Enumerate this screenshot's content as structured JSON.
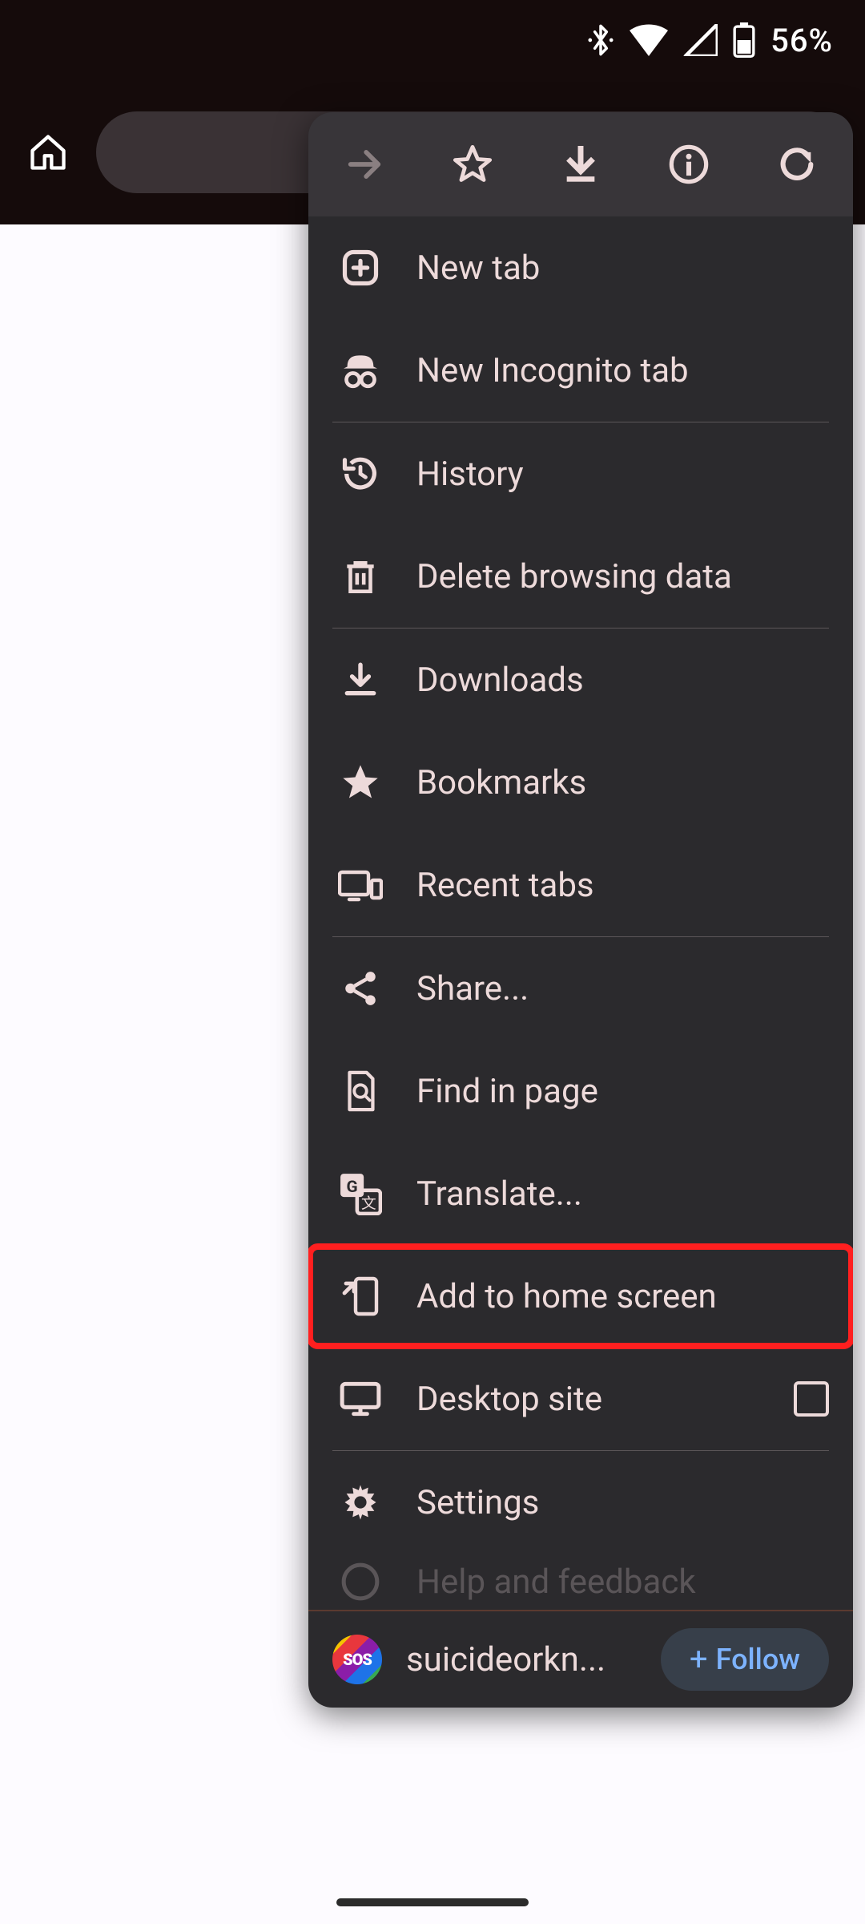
{
  "statusbar": {
    "battery_text": "56%"
  },
  "menu": {
    "items": {
      "new_tab": "New tab",
      "incognito": "New Incognito tab",
      "history": "History",
      "delete_data": "Delete browsing data",
      "downloads": "Downloads",
      "bookmarks": "Bookmarks",
      "recent_tabs": "Recent tabs",
      "share": "Share...",
      "find_in_page": "Find in page",
      "translate": "Translate...",
      "add_home": "Add to home screen",
      "desktop_site": "Desktop site",
      "settings": "Settings",
      "help": "Help and feedback"
    },
    "footer": {
      "title": "suicideorkn...",
      "follow": "Follow"
    }
  }
}
